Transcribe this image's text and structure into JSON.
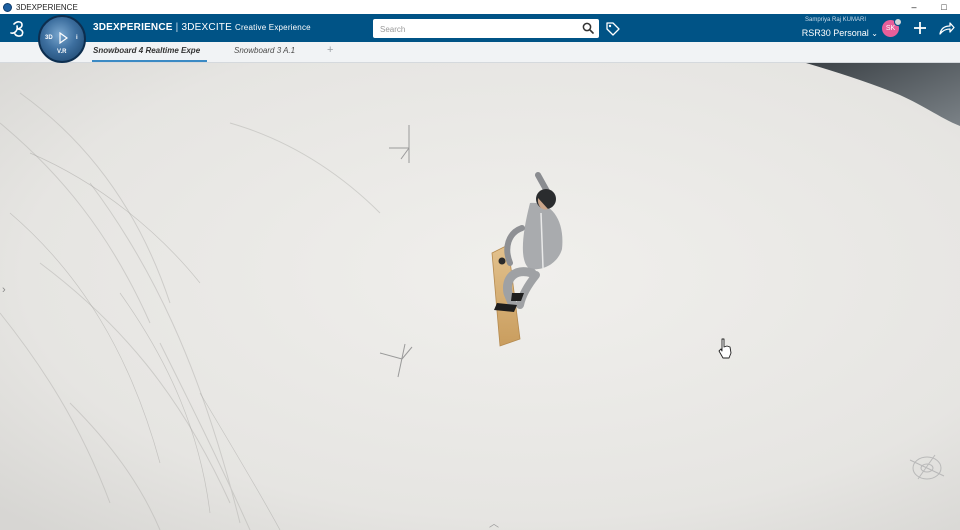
{
  "window": {
    "title": "3DEXPERIENCE",
    "minimize": "–",
    "restore": "□"
  },
  "topbar": {
    "brand_main": "3DEXPERIENCE",
    "brand_app": "3DEXCITE",
    "brand_sub": "Creative Experience",
    "compass_labels": {
      "top": "",
      "left": "3D",
      "right": "i",
      "bottom": "V.R"
    },
    "search": {
      "placeholder": "Search",
      "value": ""
    },
    "user_name": "Sampriya Raj KUMARI",
    "user_space": "RSR30 Personal",
    "avatar_initials": "SK",
    "accent_color": "#005386",
    "avatar_color": "#e85f9a"
  },
  "tabs": [
    {
      "label": "Snowboard 4 Realtime Expe",
      "active": true
    },
    {
      "label": "Snowboard 3 A.1",
      "active": false
    }
  ],
  "tab_add": "+",
  "viewport": {
    "left_handle": "›",
    "bottom_handle": "︿",
    "icons": [
      "snowboarder-model",
      "axis-gizmo-icon",
      "navigation-orb-icon",
      "hand-cursor-icon"
    ]
  }
}
